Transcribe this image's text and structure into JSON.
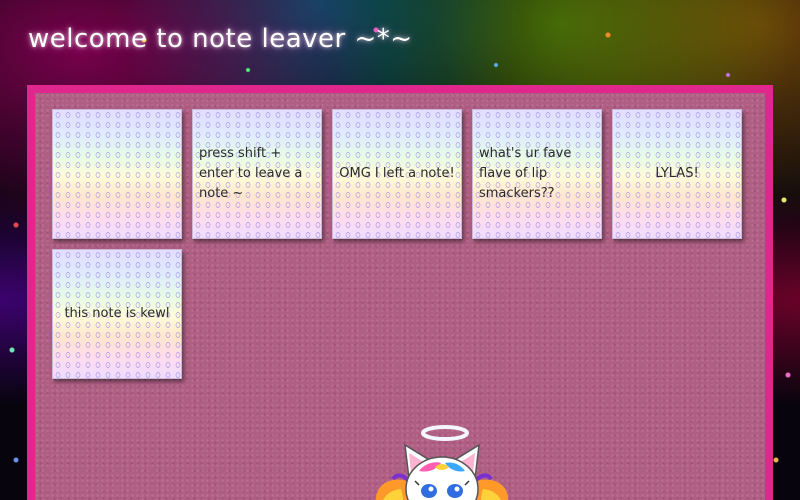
{
  "header": {
    "title": "welcome to note leaver ~*~"
  },
  "notes": [
    {
      "text": "press shift + enter to leave a note ~"
    },
    {
      "text": "OMG I left a note!"
    },
    {
      "text": "what's ur fave flave of lip smackers??"
    },
    {
      "text": "LYLAS!"
    },
    {
      "text": "this note is kewl"
    }
  ],
  "mascot": {
    "icon": "angel-kitten-icon"
  },
  "colors": {
    "board_border": "#e0278d",
    "board_fill": "#b05f84",
    "title_text": "#ffffff",
    "note_text": "#2a2a2a"
  }
}
